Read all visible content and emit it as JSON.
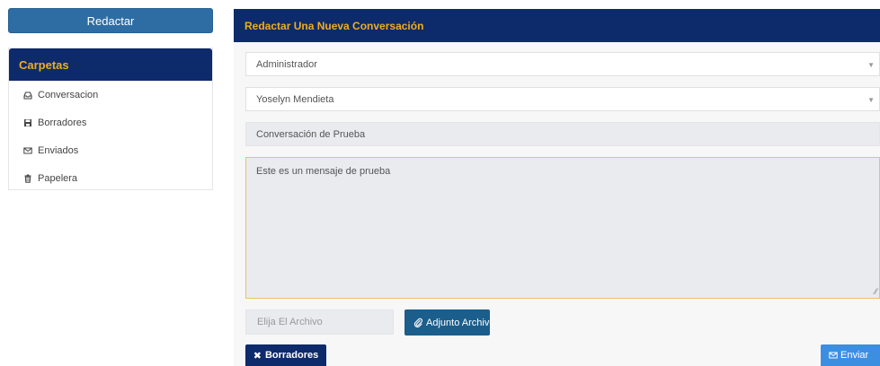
{
  "sidebar": {
    "compose_label": "Redactar",
    "folders_title": "Carpetas",
    "items": [
      {
        "label": "Conversacion",
        "icon": "inbox-icon"
      },
      {
        "label": "Borradores",
        "icon": "save-icon"
      },
      {
        "label": "Enviados",
        "icon": "envelope-icon"
      },
      {
        "label": "Papelera",
        "icon": "trash-icon"
      }
    ]
  },
  "compose": {
    "title": "Redactar Una Nueva Conversación",
    "from_value": "Administrador",
    "to_value": "Yoselyn Mendieta",
    "subject_value": "Conversación de Prueba",
    "message_value": "Este es un mensaje de prueba",
    "file_placeholder": "Elija El Archivo",
    "attach_label": "Adjunto Archivo",
    "drafts_label": "Borradores",
    "send_label": "Enviar"
  },
  "colors": {
    "navy": "#0d2a6b",
    "accent_orange": "#f0ad1c",
    "primary_blue": "#2e6da4",
    "send_blue": "#3c8fe0"
  }
}
